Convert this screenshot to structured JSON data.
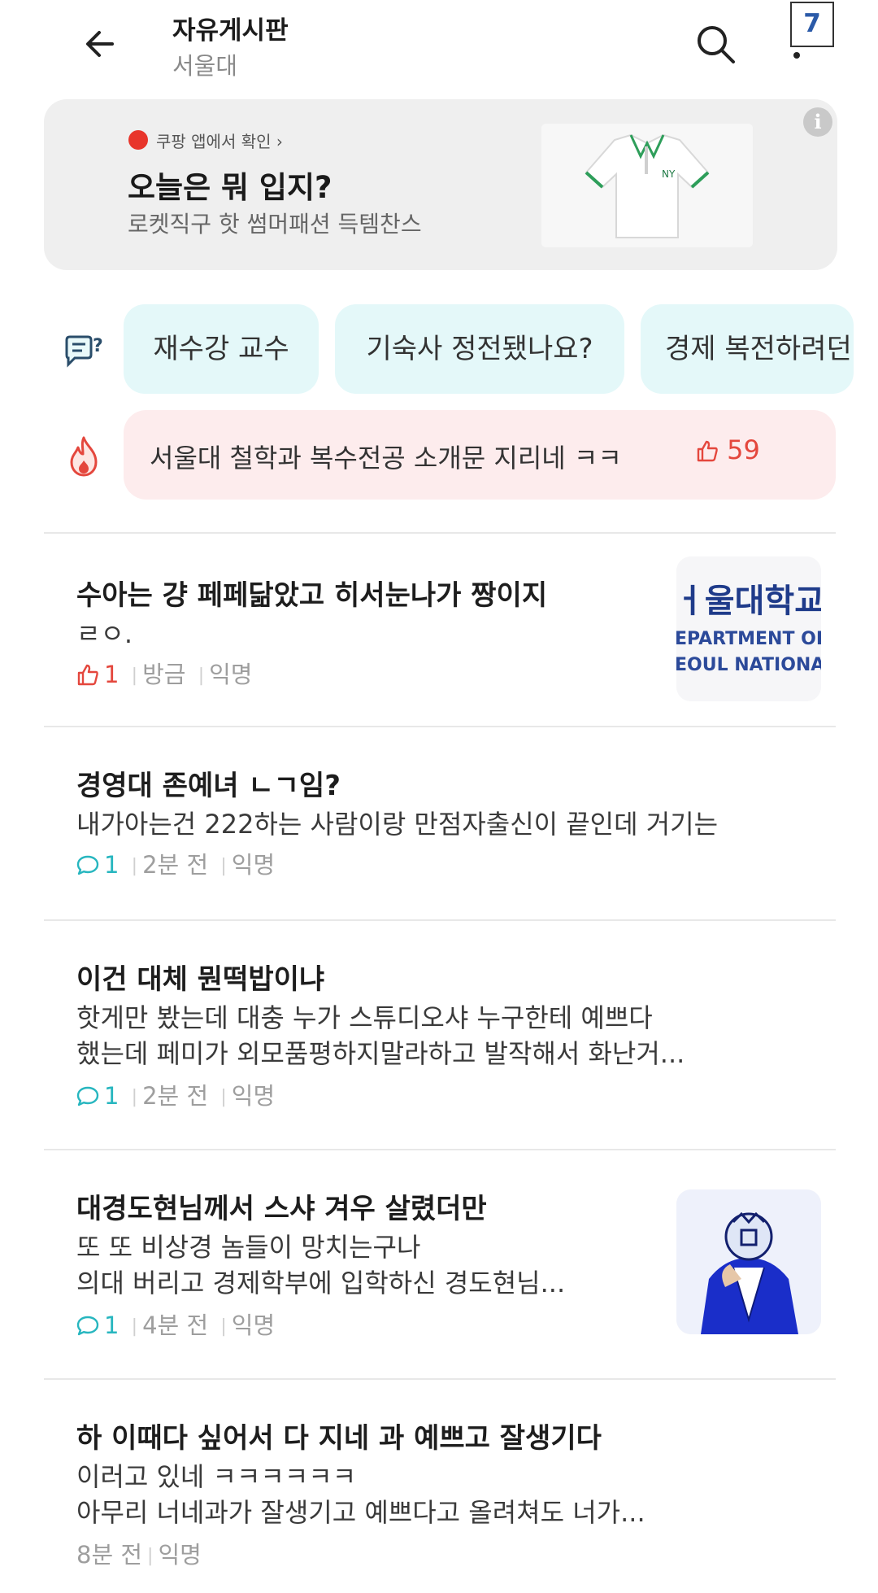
{
  "header": {
    "title": "자유게시판",
    "subtitle": "서울대",
    "notification_count": "7"
  },
  "ad": {
    "source": "쿠팡 앱에서 확인 ›",
    "title": "오늘은 뭐 입지?",
    "description": "로켓직구 핫 썸머패션 득템찬스",
    "info_icon": "info-icon"
  },
  "trending_chips": [
    {
      "label": "재수강 교수"
    },
    {
      "label": "기숙사 정전됐나요?"
    },
    {
      "label": "경제 복전하려던"
    }
  ],
  "hot_post": {
    "text": "서울대 철학과 복수전공 소개문 지리네 ㅋㅋ",
    "likes": "59"
  },
  "posts": [
    {
      "title": "수아는 걍 페페닮았고 히서눈나가 짱이지",
      "body": [
        "ㄹㅇ."
      ],
      "count": "1",
      "count_type": "like",
      "time": "방금",
      "author": "익명",
      "thumb_text": [
        "ㅓ울대학교",
        "EPARTMENT OF",
        "EOUL NATIONAL"
      ]
    },
    {
      "title": "경영대 존예녀 ㄴㄱ임?",
      "body": [
        "내가아는건 222하는 사람이랑 만점자출신이 끝인데 거기는"
      ],
      "count": "1",
      "count_type": "comment",
      "time": "2분 전",
      "author": "익명"
    },
    {
      "title": "이건 대체 뭔떡밥이냐",
      "body": [
        "핫게만 봤는데 대충 누가 스튜디오샤 누구한테 예쁘다",
        "했는데 페미가 외모품평하지말라하고 발작해서 화난거..."
      ],
      "count": "1",
      "count_type": "comment",
      "time": "2분 전",
      "author": "익명"
    },
    {
      "title": "대경도현님께서 스샤 겨우 살렸더만",
      "body": [
        "또 또 비상경 놈들이 망치는구나",
        "의대 버리고 경제학부에 입학하신 경도현님..."
      ],
      "count": "1",
      "count_type": "comment",
      "time": "4분 전",
      "author": "익명"
    },
    {
      "title": "하 이때다 싶어서 다 지네 과 예쁘고 잘생기다",
      "body": [
        "이러고 있네 ㅋㅋㅋㅋㅋㅋ",
        "아무리 너네과가 잘생기고 예쁘다고 올려쳐도 너가..."
      ],
      "time": "8분 전",
      "author": "익명"
    }
  ],
  "colors": {
    "accent_red": "#e4473d",
    "accent_teal": "#27b6bf",
    "chip_bg": "#e4f8f9",
    "hot_bg": "#fdeced"
  }
}
